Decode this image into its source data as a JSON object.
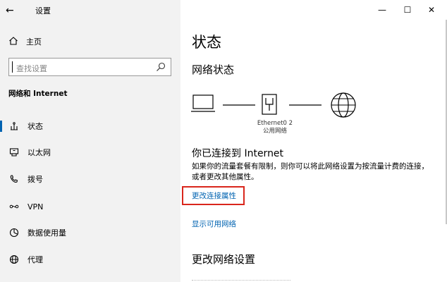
{
  "window": {
    "back_glyph": "←",
    "title": "设置",
    "minimize_glyph": "—",
    "maximize_glyph": "☐",
    "close_glyph": "✕"
  },
  "sidebar": {
    "home_label": "主页",
    "search_placeholder": "查找设置",
    "section_title": "网络和 Internet",
    "items": [
      {
        "label": "状态",
        "icon": "status-icon",
        "active": true
      },
      {
        "label": "以太网",
        "icon": "ethernet-icon",
        "active": false
      },
      {
        "label": "拨号",
        "icon": "dialup-icon",
        "active": false
      },
      {
        "label": "VPN",
        "icon": "vpn-icon",
        "active": false
      },
      {
        "label": "数据使用量",
        "icon": "data-usage-icon",
        "active": false
      },
      {
        "label": "代理",
        "icon": "globe-icon",
        "active": false
      }
    ]
  },
  "main": {
    "page_title": "状态",
    "network_status_title": "网络状态",
    "adapter_name": "Ethernet0 2",
    "network_type": "公用网络",
    "connected_title": "你已连接到 Internet",
    "description": "如果你的流量套餐有限制，则你可以将此网络设置为按流量计费的连接，或者更改其他属性。",
    "change_properties_link": "更改连接属性",
    "show_networks_link": "显示可用网络",
    "change_settings_title": "更改网络设置"
  },
  "colors": {
    "accent": "#0063b1",
    "sidebar_bg": "#f2f2f2",
    "highlight_border": "#d9261c"
  }
}
